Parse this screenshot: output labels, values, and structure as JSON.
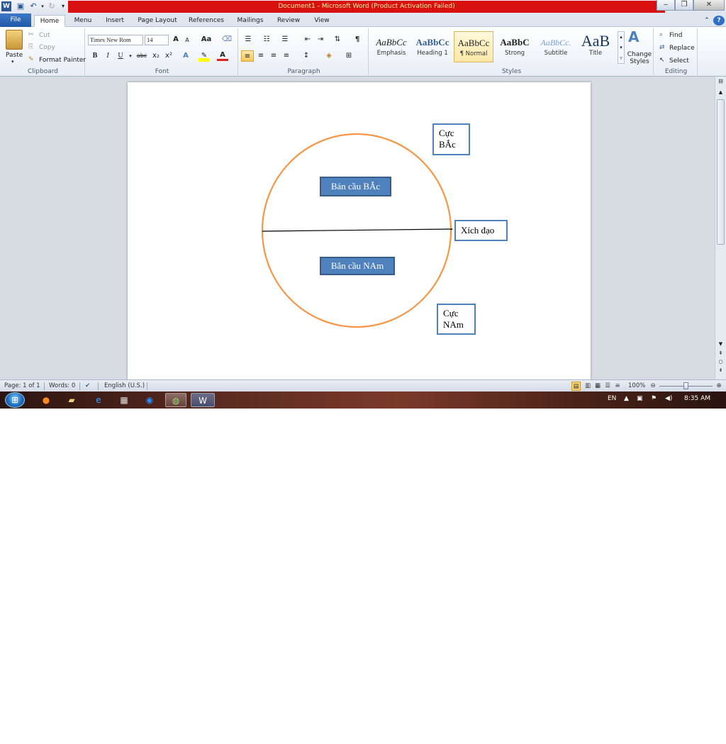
{
  "window": {
    "title": "Document1 - Microsoft Word (Product Activation Failed)",
    "title_bar_color": "#d81010"
  },
  "quick_access": {
    "word_icon": "W",
    "save_icon": "save-icon",
    "undo_icon": "undo-icon",
    "redo_icon": "redo-icon"
  },
  "tabs": [
    "File",
    "Home",
    "Menu",
    "Insert",
    "Page Layout",
    "References",
    "Mailings",
    "Review",
    "View"
  ],
  "ribbon": {
    "clipboard": {
      "paste": "Paste",
      "cut": "Cut",
      "copy": "Copy",
      "format_painter": "Format Painter",
      "label": "Clipboard"
    },
    "font": {
      "font_name": "Times New Rom",
      "font_size": "14",
      "grow": "A",
      "shrink": "A",
      "change_case": "Aa",
      "bold": "B",
      "italic": "I",
      "underline": "U",
      "strikethrough": "abc",
      "subscript": "x₂",
      "superscript": "x²",
      "label": "Font"
    },
    "paragraph": {
      "label": "Paragraph",
      "pilcrow": "¶"
    },
    "styles": {
      "items": [
        {
          "sample": "AaBbCc",
          "name": "Emphasis"
        },
        {
          "sample": "AaBbCc",
          "name": "Heading 1"
        },
        {
          "sample": "AaBbCc",
          "name": "¶ Normal"
        },
        {
          "sample": "AaBbC",
          "name": "Strong"
        },
        {
          "sample": "AaBbCc.",
          "name": "Subtitle"
        },
        {
          "sample": "AaB",
          "name": "Title"
        }
      ],
      "change_styles": "Change Styles",
      "label": "Styles"
    },
    "editing": {
      "find": "Find",
      "replace": "Replace",
      "select": "Select",
      "label": "Editing"
    }
  },
  "document": {
    "northern_hemisphere": "Bán cầu BẮc",
    "southern_hemisphere": "Bắn cầu NAm",
    "north_pole": "Cực\nBẮc",
    "equator": "Xích đạo",
    "south_pole": "Cực\nNAm",
    "circle_color": "#f79646",
    "shape_fill_color": "#4f81bd"
  },
  "status_bar": {
    "page": "Page: 1 of 1",
    "words": "Words: 0",
    "language": "English (U.S.)",
    "zoom": "100%"
  },
  "taskbar": {
    "language": "EN",
    "time": "8:35 AM"
  }
}
